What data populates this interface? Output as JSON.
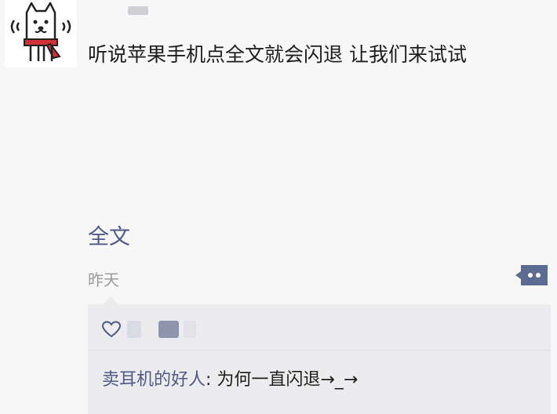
{
  "post": {
    "text": "听说苹果手机点全文就会闪退 让我们来试试",
    "full_text_link": "全文",
    "timestamp": "昨天"
  },
  "comment": {
    "author": "卖耳机的好人",
    "separator": ": ",
    "text": "为何一直闪退→_→"
  },
  "colors": {
    "link": "#4e5a85",
    "background": "#f7f7f7",
    "comment_box": "#ececee",
    "more_button": "#5c6b91"
  },
  "icons": {
    "avatar": "white-dog-with-red-scarf",
    "like": "heart-icon",
    "more": "comment-dots-icon"
  }
}
